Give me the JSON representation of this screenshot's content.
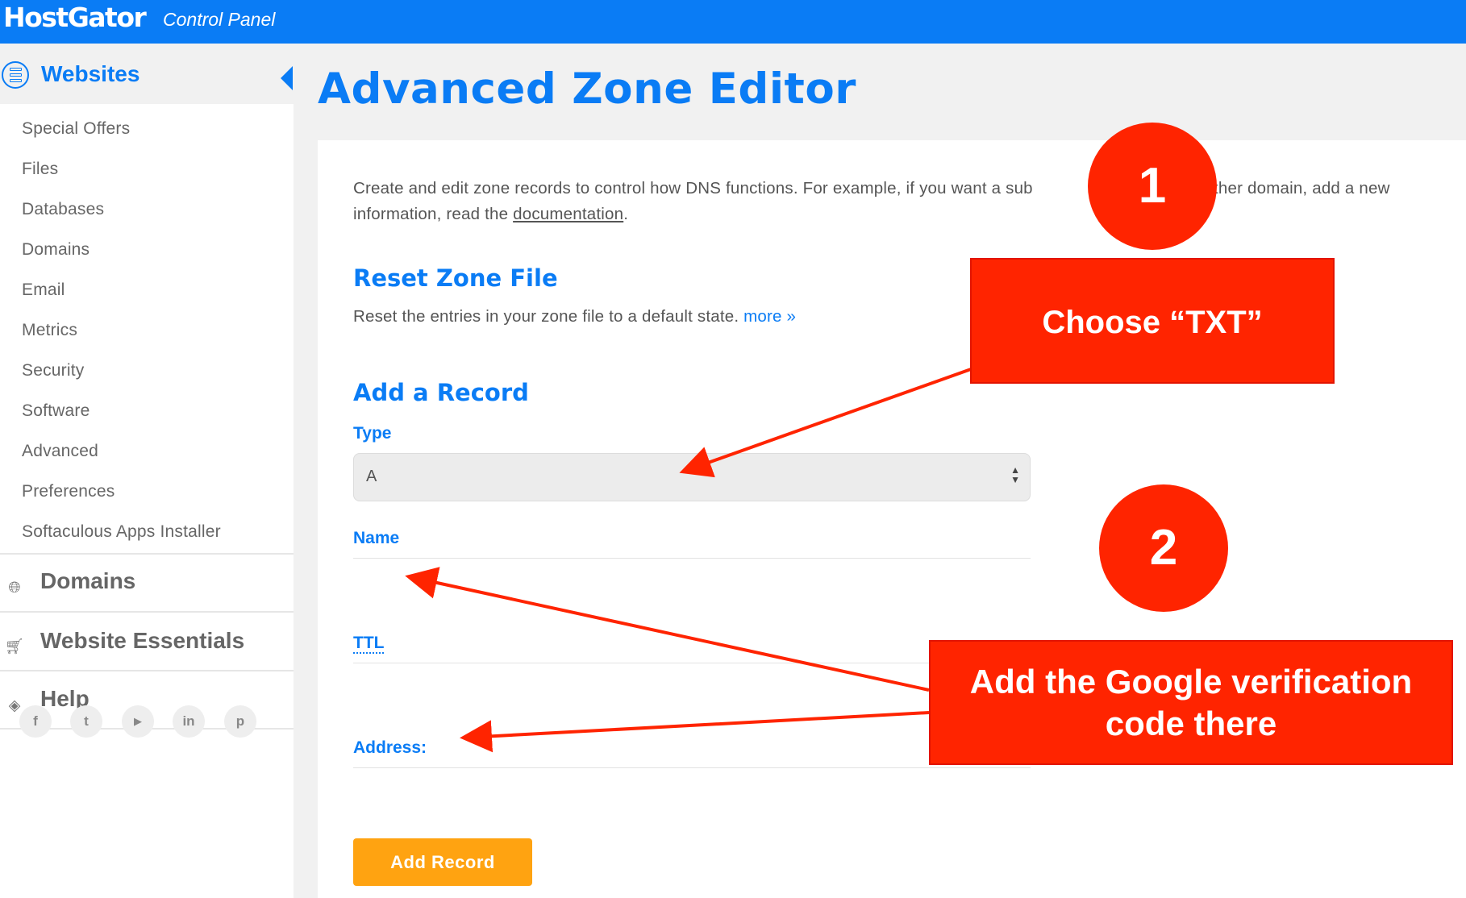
{
  "header": {
    "logo": "HostGator",
    "subtitle": "Control Panel"
  },
  "sidebar": {
    "section_title": "Websites",
    "items": [
      {
        "label": "Special Offers"
      },
      {
        "label": "Files"
      },
      {
        "label": "Databases"
      },
      {
        "label": "Domains"
      },
      {
        "label": "Email"
      },
      {
        "label": "Metrics"
      },
      {
        "label": "Security"
      },
      {
        "label": "Software"
      },
      {
        "label": "Advanced"
      },
      {
        "label": "Preferences"
      },
      {
        "label": "Softaculous Apps Installer"
      }
    ],
    "sections": [
      {
        "label": "Domains",
        "icon": "globe-icon"
      },
      {
        "label": "Website Essentials",
        "icon": "cart-icon"
      },
      {
        "label": "Help",
        "icon": "ticket-icon"
      }
    ],
    "social": [
      {
        "icon": "facebook-icon",
        "glyph": "f"
      },
      {
        "icon": "twitter-icon",
        "glyph": "t"
      },
      {
        "icon": "youtube-icon",
        "glyph": "▶"
      },
      {
        "icon": "linkedin-icon",
        "glyph": "in"
      },
      {
        "icon": "pinterest-icon",
        "glyph": "p"
      }
    ]
  },
  "page": {
    "title": "Advanced Zone Editor",
    "intro_part1": "Create and edit zone records to control how DNS functions. For example, if you want a sub",
    "intro_part2": "to another domain, add a new",
    "intro_line2_prefix": "information, read the ",
    "intro_link": "documentation",
    "intro_line2_suffix": "."
  },
  "reset": {
    "heading": "Reset Zone File",
    "description": "Reset the entries in your zone file to a default state.",
    "more_link": "more »"
  },
  "add_record": {
    "heading": "Add a Record",
    "type_label": "Type",
    "type_value": "A",
    "name_label": "Name",
    "ttl_label": "TTL",
    "address_label": "Address:",
    "button": "Add Record"
  },
  "annotations": {
    "step1": "1",
    "step2": "2",
    "callout1": "Choose “TXT”",
    "callout2_line1": "Add the Google verification",
    "callout2_line2": "code there",
    "color": "#ff2400"
  },
  "colors": {
    "brand": "#0a7cf5",
    "button": "#ffa311",
    "annotation": "#ff2400"
  }
}
